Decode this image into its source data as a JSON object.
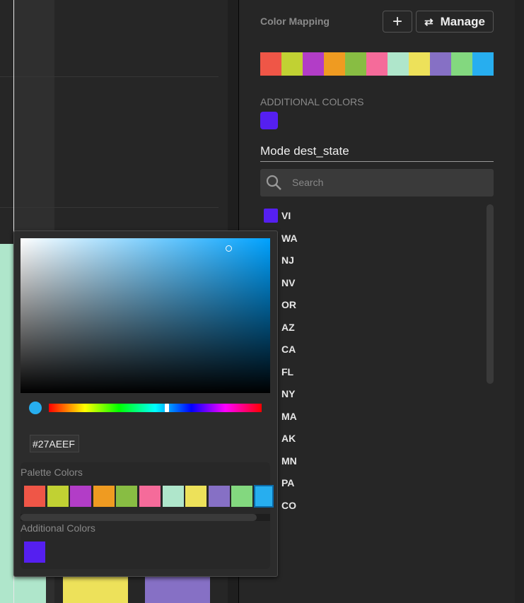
{
  "panel": {
    "title": "Color Mapping",
    "add_icon": "plus-icon",
    "manage_label": "Manage",
    "manage_icon": "swap-icon",
    "palette": [
      "#EF5647",
      "#C1D133",
      "#B23DC7",
      "#EF9B21",
      "#88BD43",
      "#F56B9A",
      "#AFE6CB",
      "#EDE15A",
      "#8670C5",
      "#83D87F",
      "#27AEEF"
    ],
    "additional_label": "ADDITIONAL COLORS",
    "additional": [
      "#551FF0"
    ],
    "mode_title": "Mode dest_state",
    "search_placeholder": "Search",
    "items": [
      {
        "label": "VI",
        "color": "#551FF0"
      },
      {
        "label": "WA"
      },
      {
        "label": "NJ"
      },
      {
        "label": "NV"
      },
      {
        "label": "OR"
      },
      {
        "label": "AZ"
      },
      {
        "label": "CA"
      },
      {
        "label": "FL"
      },
      {
        "label": "NY"
      },
      {
        "label": "MA"
      },
      {
        "label": "AK"
      },
      {
        "label": "MN"
      },
      {
        "label": "PA"
      },
      {
        "label": "CO"
      }
    ]
  },
  "picker": {
    "hex": "#27AEEF",
    "palette_label": "Palette Colors",
    "additional_label": "Additional Colors",
    "selected_index": 10
  }
}
